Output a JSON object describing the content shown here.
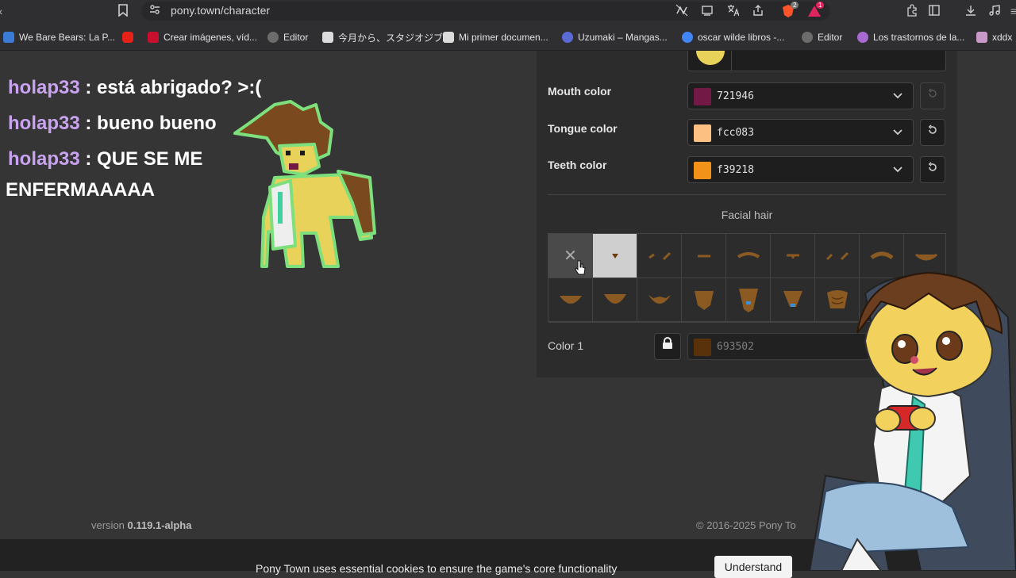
{
  "browser": {
    "url": "pony.town/character",
    "bookmarks": [
      {
        "label": "We Bare Bears: La P...",
        "color": "#3a7bd5"
      },
      {
        "label": "",
        "color": "#e62117"
      },
      {
        "label": "Crear imágenes, víd...",
        "color": "#c8102e"
      },
      {
        "label": "Editor",
        "color": "#6c6c6c"
      },
      {
        "label": "今月から、スタジオジブ...",
        "color": "#dcdcdc"
      },
      {
        "label": "Mi primer documen...",
        "color": "#dcdcdc"
      },
      {
        "label": "Uzumaki – Mangas...",
        "color": "#5b6bd6"
      },
      {
        "label": "oscar wilde libros -...",
        "color": "#4285f4"
      },
      {
        "label": "Editor",
        "color": "#6c6c6c"
      },
      {
        "label": "Los trastornos de la...",
        "color": "#a86ad1"
      },
      {
        "label": "xddx",
        "color": "#c99ac9"
      }
    ],
    "brave_badge": "2",
    "alert_badge": "1"
  },
  "chat": [
    {
      "nick": "holap33",
      "message": " : está abrigado? >:("
    },
    {
      "nick": "holap33",
      "message": " : bueno bueno"
    },
    {
      "nick": "holap33",
      "message": " : QUE SE ME"
    },
    {
      "nick": "",
      "message": "ENFERMAAAAA"
    }
  ],
  "editor": {
    "rows": [
      {
        "label": "Mouth color",
        "hex": "721946",
        "swatch": "#721946",
        "reset_enabled": false
      },
      {
        "label": "Tongue color",
        "hex": "fcc083",
        "swatch": "#fcc083",
        "reset_enabled": true
      },
      {
        "label": "Teeth color",
        "hex": "f39218",
        "swatch": "#f39218",
        "reset_enabled": true
      }
    ],
    "section_title": "Facial hair",
    "facial_hair_grid": {
      "cols": 9,
      "rows": 2,
      "total": 16,
      "selected_index": 1
    },
    "color1": {
      "label": "Color 1",
      "hex": "693502",
      "swatch": "#693502"
    }
  },
  "footer": {
    "version_prefix": "version ",
    "version": "0.119.1-alpha",
    "copyright": "© 2016-2025 Pony To"
  },
  "cookie": {
    "text": "Pony Town uses essential cookies to ensure the game's core functionality",
    "button": "Understand"
  }
}
